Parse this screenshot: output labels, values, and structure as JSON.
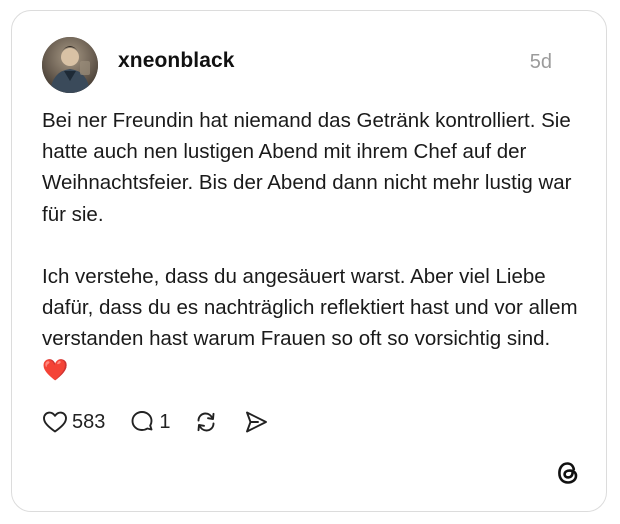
{
  "post": {
    "username": "xneonblack",
    "timestamp": "5d",
    "paragraphs": [
      "Bei ner Freundin hat niemand das Getränk kontrolliert. Sie hatte auch nen lustigen Abend mit ihrem Chef auf der Weihnachtsfeier. Bis der Abend dann nicht mehr lustig war für sie.",
      "Ich verstehe, dass du angesäuert warst. Aber viel Liebe dafür, dass du es nachträglich reflektiert hast und vor allem verstanden hast warum Frauen so oft so vorsichtig sind."
    ],
    "emoji": "❤️"
  },
  "actions": {
    "like_count": "583",
    "reply_count": "1",
    "like_icon": "heart-outline-icon",
    "reply_icon": "speech-bubble-icon",
    "repost_icon": "repost-arrows-icon",
    "share_icon": "paper-plane-icon"
  },
  "branding": {
    "logo_icon": "threads-logo-icon"
  },
  "colors": {
    "text": "#1a1a1a",
    "timestamp": "#9b9b9b",
    "border": "#dcdcdc",
    "heart_emoji": "#e0243a"
  }
}
